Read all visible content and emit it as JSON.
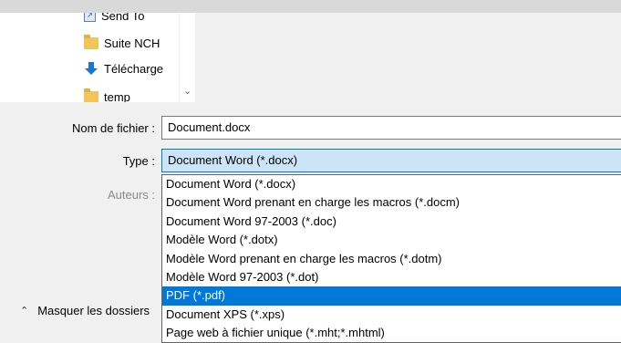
{
  "folder_tree": {
    "items": [
      {
        "label": "Send To",
        "icon": "sendto-icon"
      },
      {
        "label": "Suite NCH",
        "icon": "folder-icon"
      },
      {
        "label": "Télécharge",
        "icon": "download-arrow-icon"
      },
      {
        "label": "temp",
        "icon": "folder-icon"
      }
    ]
  },
  "form": {
    "filename_label": "Nom de fichier :",
    "filename_value": "Document.docx",
    "type_label": "Type :",
    "type_value": "Document Word (*.docx)",
    "authors_label": "Auteurs :"
  },
  "type_options": [
    {
      "label": "Document Word (*.docx)",
      "selected": false
    },
    {
      "label": "Document Word prenant en charge les macros (*.docm)",
      "selected": false
    },
    {
      "label": "Document Word 97-2003 (*.doc)",
      "selected": false
    },
    {
      "label": "Modèle Word (*.dotx)",
      "selected": false
    },
    {
      "label": "Modèle Word prenant en charge les macros (*.dotm)",
      "selected": false
    },
    {
      "label": "Modèle Word 97-2003 (*.dot)",
      "selected": false
    },
    {
      "label": "PDF (*.pdf)",
      "selected": true
    },
    {
      "label": "Document XPS (*.xps)",
      "selected": false
    },
    {
      "label": "Page web à fichier unique (*.mht;*.mhtml)",
      "selected": false
    }
  ],
  "footer": {
    "hide_folders_label": "Masquer les dossiers"
  },
  "colors": {
    "selection": "#0078d7",
    "type_box_bg": "#cce4f7",
    "folder": "#f2c55c",
    "download_arrow": "#1e73d6"
  }
}
